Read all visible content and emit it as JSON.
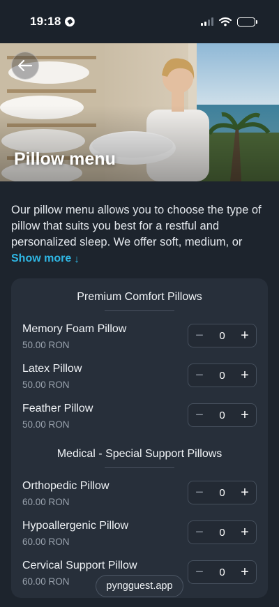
{
  "status_bar": {
    "time": "19:18"
  },
  "hero": {
    "title": "Pillow menu"
  },
  "description": {
    "text": "Our pillow menu allows you to choose the type of pillow that suits you best for a restful and personalized sleep. We offer soft, medium, or",
    "show_more_label": "Show more",
    "show_more_arrow": "↓"
  },
  "sections": [
    {
      "title": "Premium Comfort Pillows",
      "items": [
        {
          "name": "Memory Foam Pillow",
          "price": "50.00 RON",
          "quantity": "0"
        },
        {
          "name": "Latex Pillow",
          "price": "50.00 RON",
          "quantity": "0"
        },
        {
          "name": "Feather Pillow",
          "price": "50.00 RON",
          "quantity": "0"
        }
      ]
    },
    {
      "title": "Medical - Special Support Pillows",
      "items": [
        {
          "name": "Orthopedic Pillow",
          "price": "60.00 RON",
          "quantity": "0"
        },
        {
          "name": "Hypoallergenic Pillow",
          "price": "60.00 RON",
          "quantity": "0"
        },
        {
          "name": "Cervical Support Pillow",
          "price": "60.00 RON",
          "quantity": "0"
        }
      ]
    }
  ],
  "stepper": {
    "minus": "−",
    "plus": "+"
  },
  "domain": "pyngguest.app",
  "colors": {
    "accent": "#2fb7e4",
    "background": "#1d242d",
    "card": "#272f3a"
  }
}
